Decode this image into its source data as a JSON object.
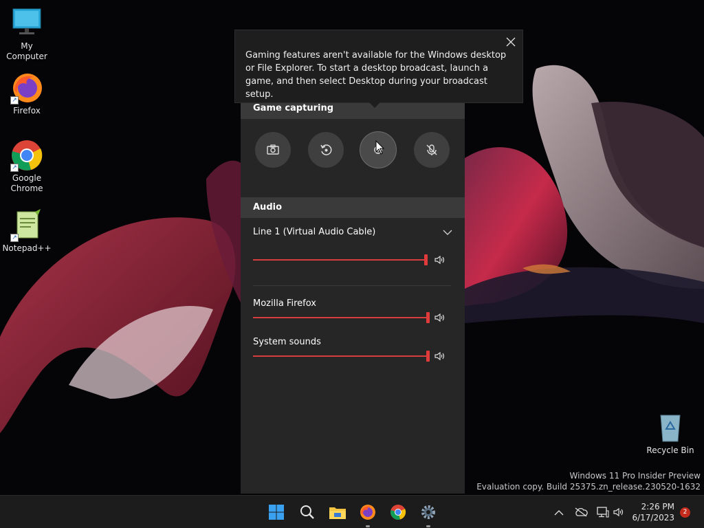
{
  "desktop": {
    "icons": [
      {
        "label": "My Computer",
        "icon": "computer-icon"
      },
      {
        "label": "Firefox",
        "icon": "firefox-icon"
      },
      {
        "label": "Google Chrome",
        "icon": "chrome-icon"
      },
      {
        "label": "Notepad++",
        "icon": "notepadpp-icon"
      },
      {
        "label": "Recycle Bin",
        "icon": "recycle-bin-icon"
      }
    ]
  },
  "tooltip": {
    "text": "Gaming features aren't available for the Windows desktop or File Explorer. To start a desktop broadcast, launch a game, and then select Desktop during your broadcast setup.",
    "close_icon": "close-icon"
  },
  "capture": {
    "heading": "Game capturing",
    "buttons": [
      {
        "name": "screenshot",
        "icon": "camera-icon"
      },
      {
        "name": "record-last",
        "icon": "replay-icon"
      },
      {
        "name": "record",
        "icon": "record-dot-icon"
      },
      {
        "name": "mic",
        "icon": "mic-off-icon"
      }
    ]
  },
  "audio": {
    "heading": "Audio",
    "device": "Line 1 (Virtual Audio Cable)",
    "device_volume": 100,
    "apps": [
      {
        "label": "Mozilla Firefox",
        "volume": 100
      },
      {
        "label": "System sounds",
        "volume": 100
      }
    ]
  },
  "watermark": {
    "line1": "Windows 11 Pro Insider Preview",
    "line2": "Evaluation copy. Build 25375.zn_release.230520-1632"
  },
  "taskbar": {
    "time": "2:26 PM",
    "date": "6/17/2023",
    "notifications": "2"
  },
  "colors": {
    "accent": "#e03a3a",
    "panel": "#262626",
    "taskbar": "#1c1c1c"
  }
}
